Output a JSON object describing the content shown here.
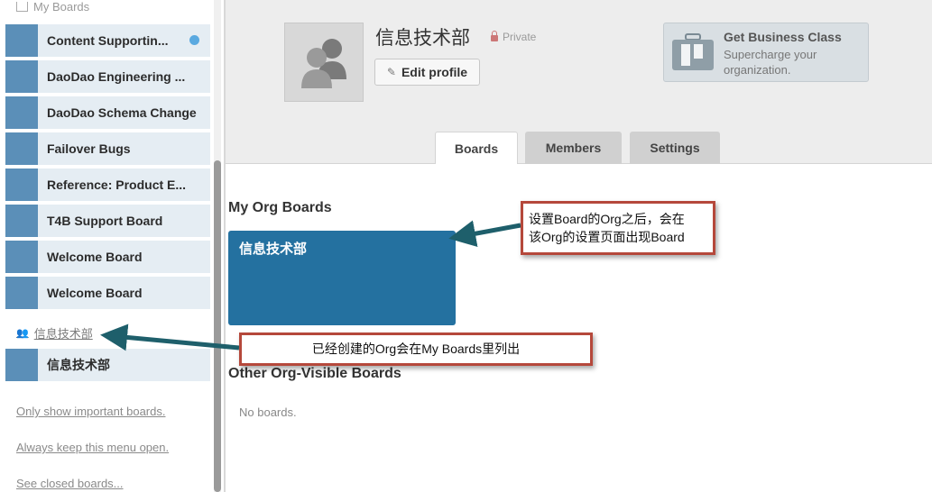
{
  "sidebar": {
    "header": "My Boards",
    "boards": [
      {
        "name": "Content Supportin...",
        "has_dot": true
      },
      {
        "name": "DaoDao Engineering ..."
      },
      {
        "name": "DaoDao Schema Change"
      },
      {
        "name": "Failover Bugs"
      },
      {
        "name": "Reference: Product E..."
      },
      {
        "name": "T4B Support Board"
      },
      {
        "name": "Welcome Board"
      },
      {
        "name": "Welcome Board"
      }
    ],
    "org_link": "信息技术部",
    "org_board": "信息技术部",
    "links": {
      "important": "Only show important boards.",
      "keep_open": "Always keep this menu open.",
      "closed": "See closed boards..."
    }
  },
  "header": {
    "org_name": "信息技术部",
    "privacy": "Private",
    "edit_profile": "Edit profile",
    "business": {
      "title": "Get Business Class",
      "subtitle": "Supercharge your organization."
    }
  },
  "tabs": {
    "boards": "Boards",
    "members": "Members",
    "settings": "Settings"
  },
  "content": {
    "my_org_boards": "My Org Boards",
    "board_tile": "信息技术部",
    "other_boards": "Other Org-Visible Boards",
    "no_boards": "No boards."
  },
  "annotations": {
    "callout1_line1": "设置Board的Org之后，会在",
    "callout1_line2": "该Org的设置页面出现Board",
    "callout2": "已经创建的Org会在My  Boards里列出"
  },
  "colors": {
    "board_swatch": "#5b8fb8",
    "board_tile": "#2471a0",
    "annotation_border": "#b5483b",
    "arrow": "#1e5f6b"
  }
}
